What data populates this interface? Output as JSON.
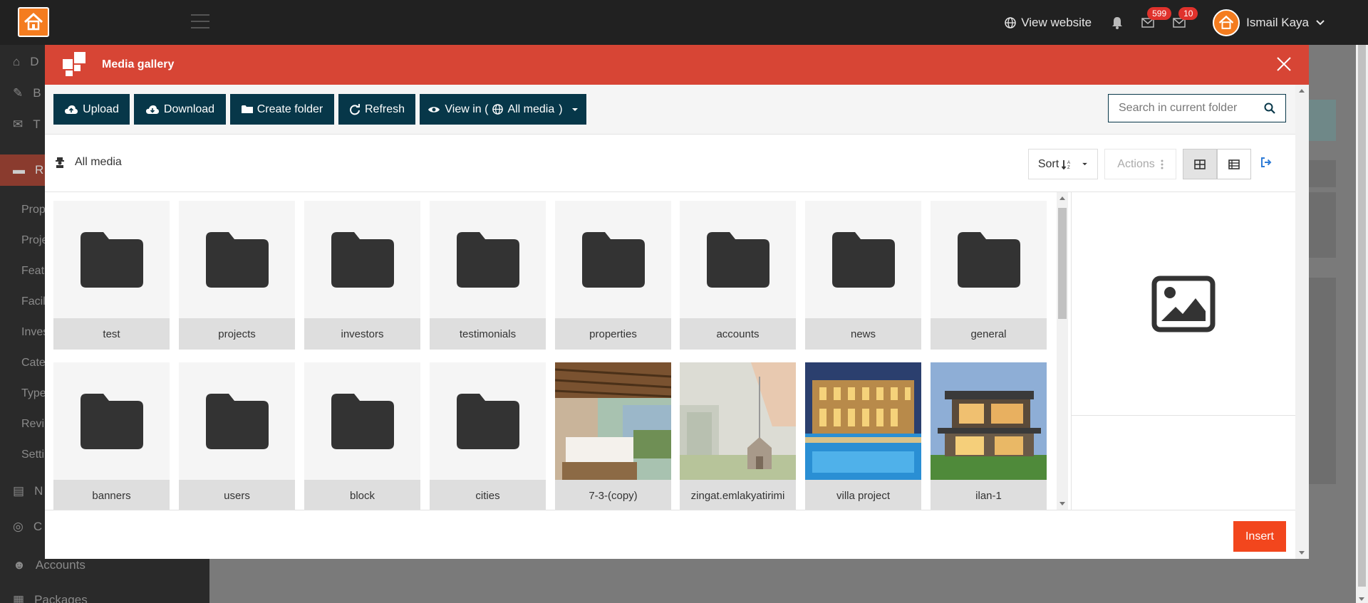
{
  "topbar": {
    "view_website": "View website",
    "notifications_badge": "599",
    "messages_badge": "10",
    "user_name": "Ismail Kaya"
  },
  "sidebar": {
    "items": [
      {
        "label": "D",
        "icon": "home-icon"
      },
      {
        "label": "B",
        "icon": "edit-icon"
      },
      {
        "label": "T",
        "icon": "comment-icon"
      },
      {
        "label": "R",
        "icon": "bed-icon"
      }
    ],
    "sub_items": [
      "Prop",
      "Proje",
      "Feat",
      "Facil",
      "Inves",
      "Cate",
      "Type",
      "Revi",
      "Setti"
    ],
    "lower_items": [
      {
        "label": "N",
        "icon": "newspaper-icon"
      },
      {
        "label": "C",
        "icon": "headset-icon"
      },
      {
        "label": "Accounts",
        "icon": "users-icon"
      },
      {
        "label": "Packages",
        "icon": "package-icon"
      }
    ]
  },
  "modal": {
    "title": "Media gallery",
    "toolbar": {
      "upload": "Upload",
      "download": "Download",
      "create_folder": "Create folder",
      "refresh": "Refresh",
      "view_in_prefix": "View in (",
      "view_in_value": "All media",
      "view_in_suffix": ")",
      "search_placeholder": "Search in current folder"
    },
    "breadcrumb": "All media",
    "sort_label": "Sort",
    "actions_label": "Actions",
    "insert_label": "Insert"
  },
  "items": [
    {
      "name": "test",
      "type": "folder"
    },
    {
      "name": "projects",
      "type": "folder"
    },
    {
      "name": "investors",
      "type": "folder"
    },
    {
      "name": "testimonials",
      "type": "folder"
    },
    {
      "name": "properties",
      "type": "folder"
    },
    {
      "name": "accounts",
      "type": "folder"
    },
    {
      "name": "news",
      "type": "folder"
    },
    {
      "name": "general",
      "type": "folder"
    },
    {
      "name": "banners",
      "type": "folder"
    },
    {
      "name": "users",
      "type": "folder"
    },
    {
      "name": "block",
      "type": "folder"
    },
    {
      "name": "cities",
      "type": "folder"
    },
    {
      "name": "7-3-(copy)",
      "type": "image"
    },
    {
      "name": "zingat.emlakyatirimi",
      "type": "image"
    },
    {
      "name": "villa project",
      "type": "image"
    },
    {
      "name": "ilan-1",
      "type": "image"
    }
  ],
  "colors": {
    "header": "#d74535",
    "toolbar_button": "#073749",
    "insert_button": "#f2461d",
    "brand": "#f47c1f"
  }
}
